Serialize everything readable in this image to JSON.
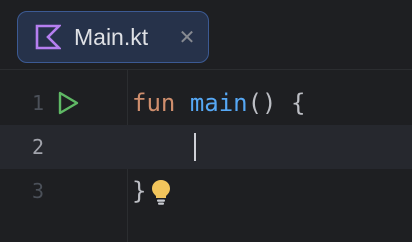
{
  "tab": {
    "label": "Main.kt",
    "icon": "kotlin-file-icon",
    "close_icon": "close-icon"
  },
  "editor": {
    "lines": [
      {
        "number": "1",
        "tokens": [
          {
            "text": "fun",
            "kind": "keyword"
          },
          {
            "text": " ",
            "kind": "plain"
          },
          {
            "text": "main",
            "kind": "function"
          },
          {
            "text": "() {",
            "kind": "plain"
          }
        ],
        "gutter_icon": "run-icon"
      },
      {
        "number": "2",
        "tokens": [],
        "current": true
      },
      {
        "number": "3",
        "tokens": [
          {
            "text": "}",
            "kind": "plain"
          }
        ],
        "inline_icon": "lightbulb-icon"
      }
    ]
  },
  "colors": {
    "background": "#1e1f22",
    "keyword": "#cf8e6d",
    "function": "#56a8f5",
    "text": "#bcbec4",
    "tab_border": "#3c5a93",
    "run_green": "#5fb865",
    "bulb_yellow": "#f2c55c"
  }
}
